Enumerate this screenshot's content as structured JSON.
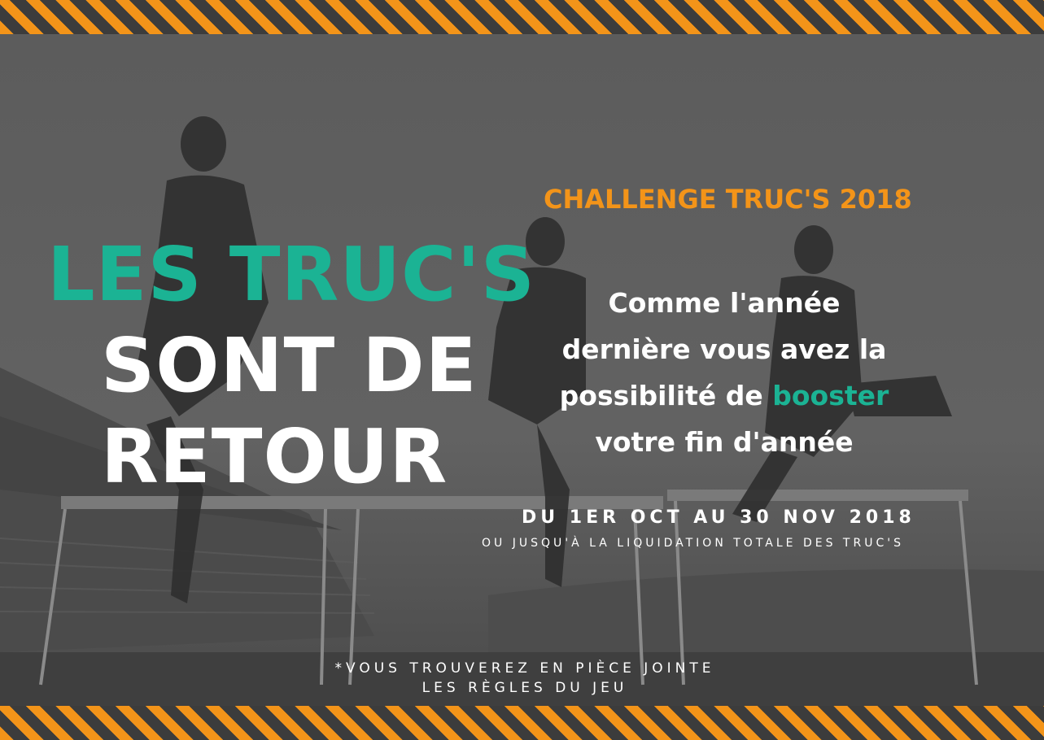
{
  "poster": {
    "challenge": "CHALLENGE TRUC'S 2018",
    "headline": {
      "line1": "LES TRUC'S",
      "line2": "SONT DE",
      "line3": "RETOUR"
    },
    "message": {
      "line1": "Comme l'année",
      "line2": "dernière vous avez la",
      "line3_before": "possibilité de ",
      "line3_highlight": "booster",
      "line4": "votre fin d'année"
    },
    "dates": "DU 1ER OCT AU 30 NOV 2018",
    "subtitle": "OU JUSQU'À LA LIQUIDATION TOTALE DES TRUC'S",
    "note": {
      "line1": "*VOUS TROUVEREZ EN PIÈCE JOINTE",
      "line2": "LES RÈGLES DU JEU"
    }
  },
  "colors": {
    "orange": "#f39419",
    "teal": "#1bb394",
    "white": "#ffffff",
    "overlay": "#555555"
  }
}
